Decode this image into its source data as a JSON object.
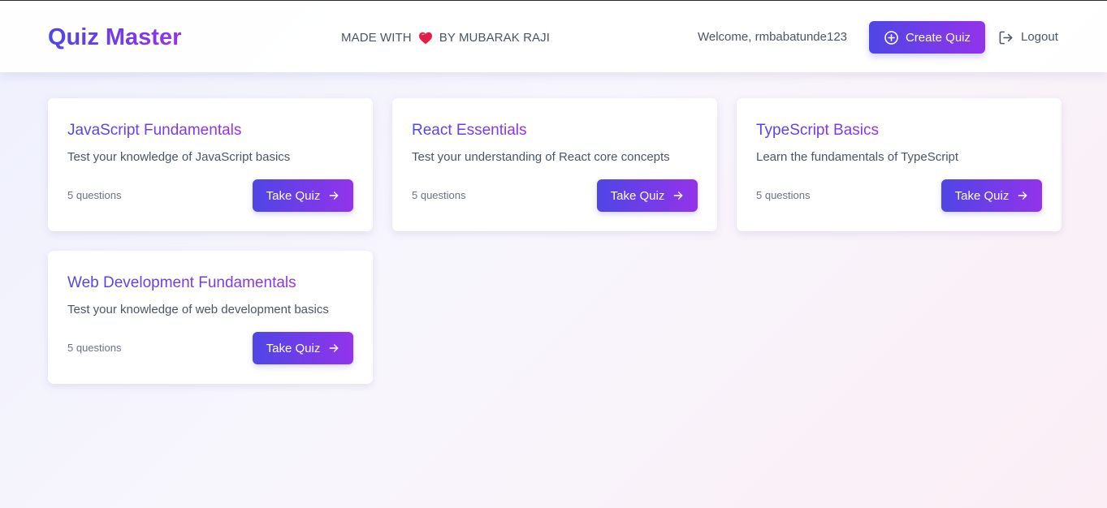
{
  "header": {
    "logo": "Quiz Master",
    "made_prefix": "MADE WITH",
    "made_suffix": "BY MUBARAK RAJI",
    "heart_icon": "heart-icon",
    "welcome": "Welcome, rmbabatunde123",
    "create_label": "Create Quiz",
    "create_icon": "plus-circle-icon",
    "logout_label": "Logout",
    "logout_icon": "logout-icon"
  },
  "colors": {
    "brand_start": "#4f46e5",
    "brand_end": "#9333ea",
    "heart": "#e11d48"
  },
  "quizzes": [
    {
      "title": "JavaScript Fundamentals",
      "description": "Test your knowledge of JavaScript basics",
      "count": "5 questions",
      "button": "Take Quiz"
    },
    {
      "title": "React Essentials",
      "description": "Test your understanding of React core concepts",
      "count": "5 questions",
      "button": "Take Quiz"
    },
    {
      "title": "TypeScript Basics",
      "description": "Learn the fundamentals of TypeScript",
      "count": "5 questions",
      "button": "Take Quiz"
    },
    {
      "title": "Web Development Fundamentals",
      "description": "Test your knowledge of web development basics",
      "count": "5 questions",
      "button": "Take Quiz"
    }
  ]
}
